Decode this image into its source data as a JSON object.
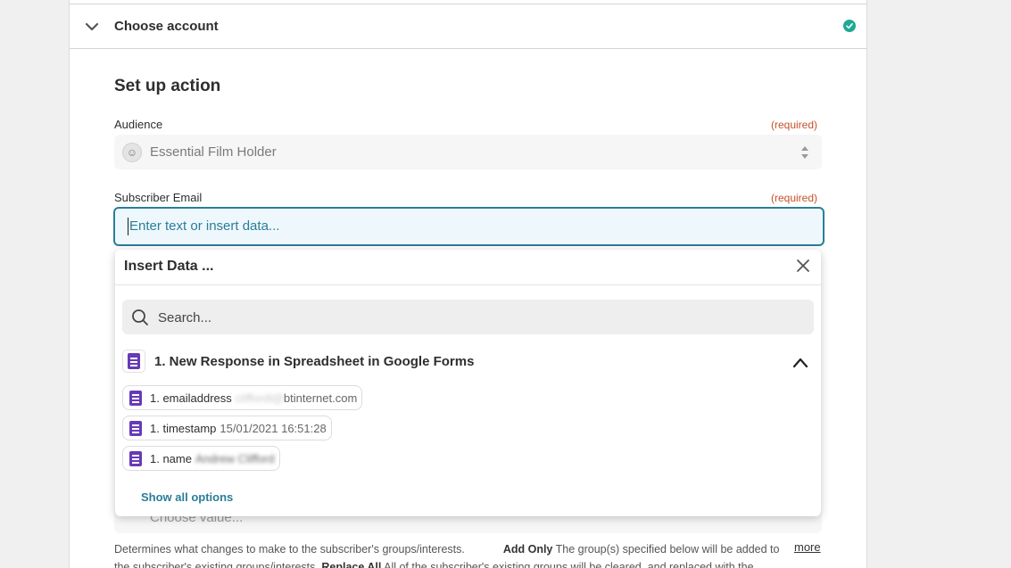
{
  "account_section": {
    "title": "Choose account",
    "status_icon": "check-circle-icon",
    "status_color": "#1fa995"
  },
  "setup": {
    "title": "Set up action",
    "required_label": "(required)",
    "audience": {
      "label": "Audience",
      "value": "Essential Film Holder"
    },
    "subscriber_email": {
      "label": "Subscriber Email",
      "placeholder": "Enter text or insert data..."
    }
  },
  "insert_data": {
    "title": "Insert Data ...",
    "search_placeholder": "Search...",
    "group": {
      "title": "1. New Response in Spreadsheet in Google Forms"
    },
    "items": [
      {
        "key": "1. emailaddress",
        "value_hidden": "cliffordl@",
        "value_visible": "btinternet.com"
      },
      {
        "key": "1. timestamp",
        "value_visible": "15/01/2021 16:51:28"
      },
      {
        "key": "1. name",
        "value_hidden": "Andrew Clifford"
      }
    ],
    "show_all": "Show all options"
  },
  "groups_select": {
    "placeholder": "Choose value..."
  },
  "help": {
    "text1": "Determines what changes to make to the subscriber's groups/interests.",
    "add_only_label": "Add Only",
    "text2": "The group(s) specified below will be added to",
    "text3": "the subscriber's existing groups/interests.",
    "replace_all_label": "Replace All",
    "text4": "All of the subscriber's existing groups will be cleared, and replaced with the...",
    "more": "more"
  },
  "colors": {
    "accent": "#2a7d98",
    "required": "#c8502a",
    "forms_purple": "#673ab7"
  }
}
